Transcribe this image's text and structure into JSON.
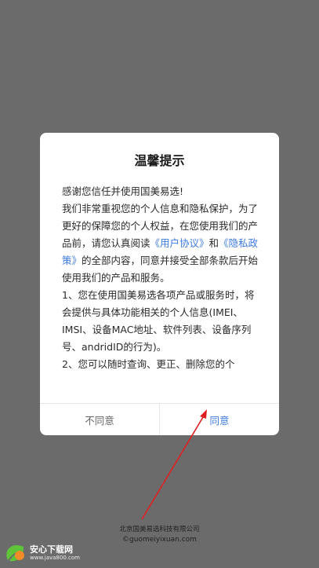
{
  "dialog": {
    "title": "温馨提示",
    "p1": "感谢您信任并使用国美易选!",
    "p2_a": "我们非常重视您的个人信息和隐私保护，为了更好的保障您的个人权益，在您使用我们的产品前，请您认真阅读",
    "link_user_agreement": "《用户协议》",
    "p2_and": "和",
    "link_privacy_policy": "《隐私政策》",
    "p2_b": "的全部内容，同意并接受全部条款后开始使用我们的产品和服务。",
    "p3": "1、您在使用国美易选各项产品或服务时，将会提供与具体功能相关的个人信息(IMEI、IMSI、设备MAC地址、软件列表、设备序列号、andridID的行为)。",
    "p4": "2、您可以随时查询、更正、删除您的个",
    "decline_label": "不同意",
    "agree_label": "同意",
    "link_color": "#3d7be0"
  },
  "footer": {
    "company": "北京国美易选科技有限公司",
    "domain": "©guomeiyixuan.com"
  },
  "watermark": {
    "title": "安心下载网",
    "url": "www.java800.com",
    "logo": "leaf-logo-icon"
  },
  "annotation": {
    "color": "#e02020"
  }
}
